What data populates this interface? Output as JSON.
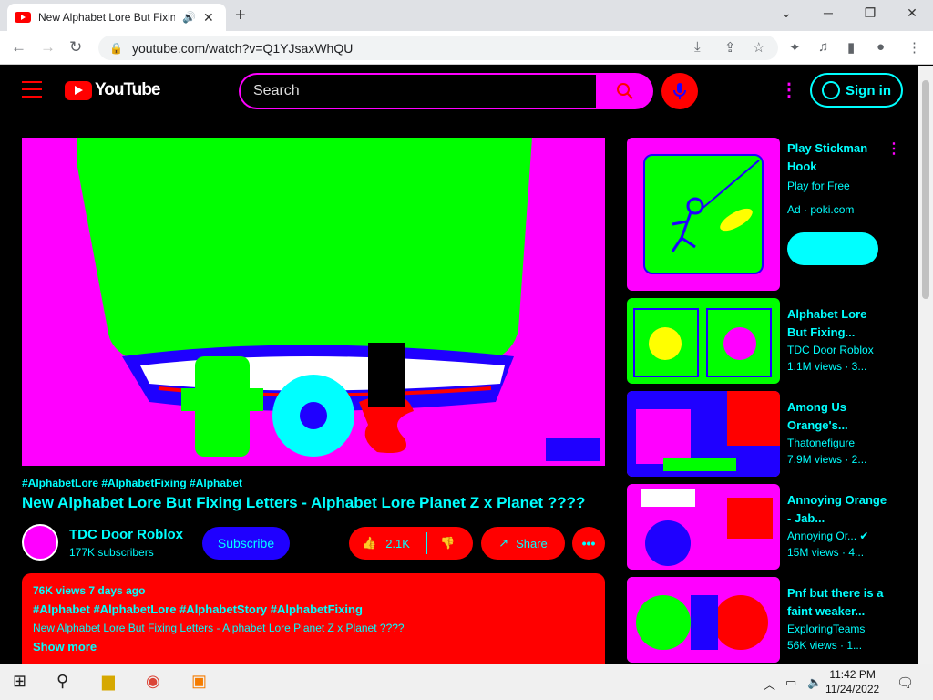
{
  "browser": {
    "tab_title": "New Alphabet Lore But Fixing Letters",
    "new_tab_glyph": "+",
    "url": "youtube.com/watch?v=Q1YJsaxWhQU",
    "icons": [
      "back-icon",
      "forward-icon",
      "reload-icon",
      "lock-icon",
      "install-icon",
      "share-icon",
      "star-icon",
      "extensions-icon",
      "media-icon",
      "sidepanel-icon",
      "profile-icon",
      "menu-icon"
    ]
  },
  "header": {
    "logo_text": "YouTube",
    "search_placeholder": "Search",
    "signin_label": "Sign in"
  },
  "video": {
    "tags": "#AlphabetLore #AlphabetFixing #Alphabet",
    "title": "New Alphabet Lore But Fixing Letters - Alphabet Lore Planet Z x Planet ????",
    "channel_name": "TDC Door Roblox",
    "subscribers": "177K subscribers",
    "subscribe_label": "Subscribe",
    "likes": "2.1K",
    "share_label": "Share",
    "more_label": "•••"
  },
  "description": {
    "meta": "76K views  7 days ago",
    "hashtags": "#Alphabet #AlphabetLore #AlphabetStory #AlphabetFixing",
    "line": "New Alphabet Lore But Fixing Letters - Alphabet Lore Planet Z x Planet ????",
    "show_more": "Show more"
  },
  "ad": {
    "title": "Play Stickman Hook",
    "subtitle": "Play for Free",
    "sponsor": "Ad · poki.com"
  },
  "recommendations": [
    {
      "title": "Alphabet Lore But Fixing...",
      "channel": "TDC Door Roblox",
      "views": "1.1M views · 3..."
    },
    {
      "title": "Among Us Orange's...",
      "channel": "Thatonefigure",
      "views": "7.9M views · 2..."
    },
    {
      "title": "Annoying Orange - Jab...",
      "channel": "Annoying Or... ✔",
      "views": "15M views · 4..."
    },
    {
      "title": "Pnf but there is a faint weaker...",
      "channel": "ExploringTeams",
      "views": "56K views · 1..."
    }
  ],
  "taskbar": {
    "time": "11:42 PM",
    "date": "11/24/2022"
  },
  "colors": {
    "accent_cyan": "#00ffff",
    "accent_magenta": "#ff00ff",
    "accent_red": "#ff0000",
    "accent_blue": "#1f00ff",
    "accent_green": "#00ff00"
  }
}
